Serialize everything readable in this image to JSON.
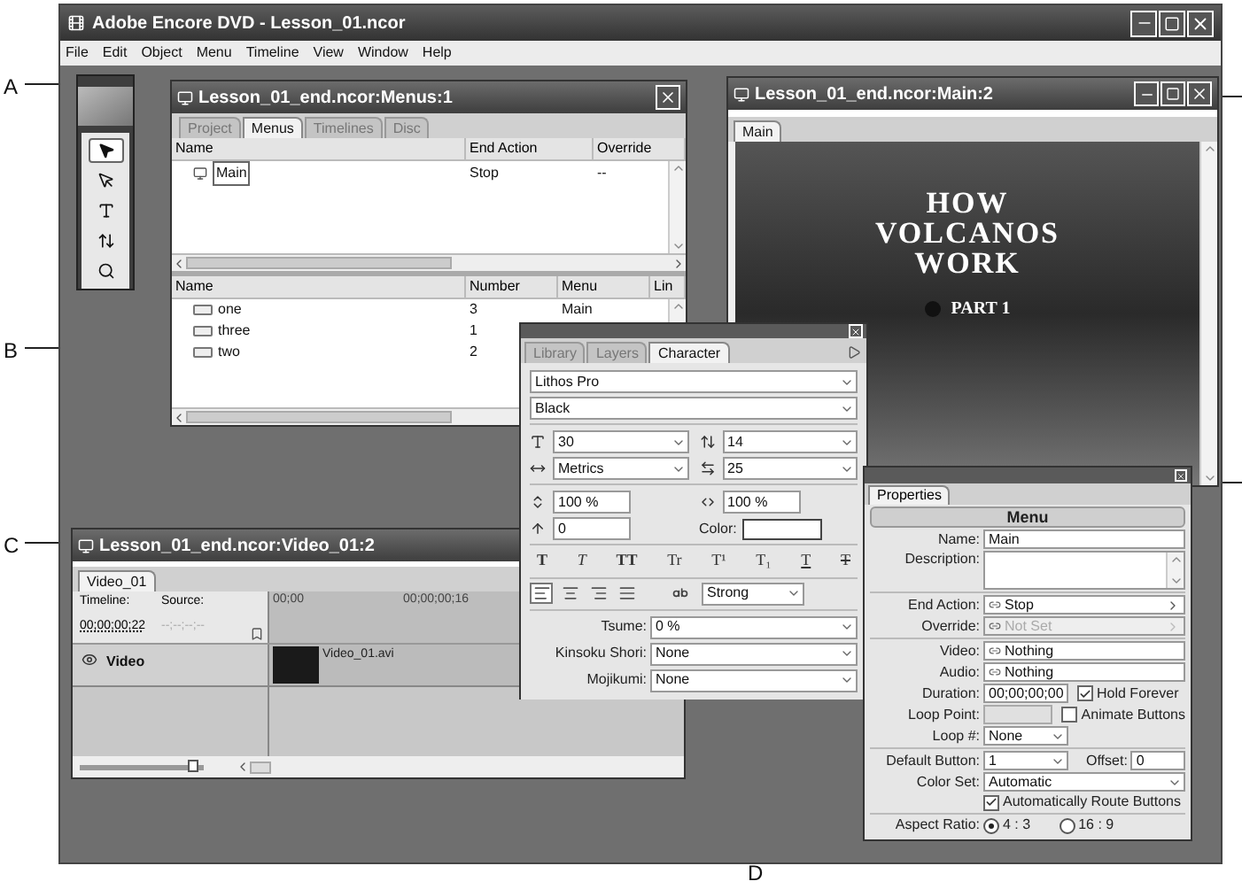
{
  "callouts": [
    {
      "label": "A"
    },
    {
      "label": "B"
    },
    {
      "label": "C"
    },
    {
      "label": "D"
    }
  ],
  "app": {
    "title": "Adobe Encore DVD - Lesson_01.ncor",
    "menu": [
      "File",
      "Edit",
      "Object",
      "Menu",
      "Timeline",
      "View",
      "Window",
      "Help"
    ]
  },
  "tools": [
    {
      "kind": "select",
      "selected": true
    },
    {
      "kind": "direct",
      "selected": false
    },
    {
      "kind": "text",
      "selected": false
    },
    {
      "kind": "vtext",
      "selected": false
    },
    {
      "kind": "zoom",
      "selected": false
    }
  ],
  "menus_window": {
    "title": "Lesson_01_end.ncor:Menus:1",
    "tabs": [
      {
        "label": "Project",
        "selected": false
      },
      {
        "label": "Menus",
        "selected": true
      },
      {
        "label": "Timelines",
        "selected": false
      },
      {
        "label": "Disc",
        "selected": false
      }
    ],
    "menus_table": {
      "columns": [
        "Name",
        "End Action",
        "Override"
      ],
      "rows": [
        {
          "name": "Main",
          "end_action": "Stop",
          "override": "--"
        }
      ]
    },
    "buttons_table": {
      "columns": [
        "Name",
        "Number",
        "Menu",
        "Lin"
      ],
      "rows": [
        {
          "name": "one",
          "number": "3",
          "menu": "Main"
        },
        {
          "name": "three",
          "number": "1"
        },
        {
          "name": "two",
          "number": "2"
        }
      ]
    }
  },
  "preview_window": {
    "title": "Lesson_01_end.ncor:Main:2",
    "tab": {
      "label": "Main",
      "selected": true
    },
    "headline": [
      "HOW",
      "VOLCANOS",
      "WORK"
    ],
    "button_label": "PART 1"
  },
  "character_panel": {
    "tabs": [
      {
        "label": "Library",
        "selected": false
      },
      {
        "label": "Layers",
        "selected": false
      },
      {
        "label": "Character",
        "selected": true
      }
    ],
    "font": "Lithos Pro",
    "style": "Black",
    "size": "30",
    "leading": "14",
    "kerning": "Metrics",
    "tracking": "25",
    "vertical_scale": "100 %",
    "horizontal_scale": "100 %",
    "baseline_shift": "0",
    "color_label": "Color:",
    "style_buttons": [
      {
        "glyph": "T",
        "kind": "bold"
      },
      {
        "glyph": "T",
        "kind": "italic"
      },
      {
        "glyph": "TT",
        "kind": "caps"
      },
      {
        "glyph": "Tr",
        "kind": "smallcaps"
      },
      {
        "glyph": "T¹",
        "kind": "super"
      },
      {
        "glyph": "T₁",
        "kind": "sub"
      },
      {
        "glyph": "T",
        "kind": "underline"
      },
      {
        "glyph": "T",
        "kind": "strike"
      }
    ],
    "alignments": [
      {
        "kind": "left",
        "selected": true
      },
      {
        "kind": "center",
        "selected": false
      },
      {
        "kind": "right",
        "selected": false
      },
      {
        "kind": "justify",
        "selected": false
      }
    ],
    "antialias": "Strong",
    "tsume": {
      "label": "Tsume:",
      "value": "0 %"
    },
    "kinsoku": {
      "label": "Kinsoku Shori:",
      "value": "None"
    },
    "mojikumi": {
      "label": "Mojikumi:",
      "value": "None"
    }
  },
  "properties": {
    "tab": "Properties",
    "header": "Menu",
    "name": {
      "label": "Name:",
      "value": "Main"
    },
    "description": {
      "label": "Description:"
    },
    "end_action": {
      "label": "End Action:",
      "value": "Stop",
      "disabled": false
    },
    "override": {
      "label": "Override:",
      "value": "Not Set",
      "disabled": true
    },
    "video": {
      "label": "Video:",
      "value": "Nothing"
    },
    "audio": {
      "label": "Audio:",
      "value": "Nothing"
    },
    "duration": {
      "label": "Duration:",
      "value": "00;00;00;00"
    },
    "hold_forever": {
      "label": "Hold Forever",
      "checked": true
    },
    "loop_point": {
      "label": "Loop Point:"
    },
    "animate_buttons": {
      "label": "Animate Buttons",
      "checked": false
    },
    "loop": {
      "label": "Loop #:",
      "value": "None"
    },
    "default_button": {
      "label": "Default Button:",
      "value": "1"
    },
    "offset": {
      "label": "Offset:",
      "value": "0"
    },
    "color_set": {
      "label": "Color Set:",
      "value": "Automatic"
    },
    "auto_route": {
      "label": "Automatically Route Buttons",
      "checked": true
    },
    "aspect_ratio": {
      "label": "Aspect Ratio:",
      "options": [
        {
          "label": "4 : 3",
          "selected": true
        },
        {
          "label": "16 : 9",
          "selected": false
        }
      ]
    }
  },
  "video_window": {
    "title": "Lesson_01_end.ncor:Video_01:2",
    "tab": {
      "label": "Video_01",
      "selected": true
    },
    "timeline_label": "Timeline:",
    "timeline_value": "00;00;00;22",
    "source_label": "Source:",
    "source_value": "--;--;--;--",
    "ruler": [
      "00;00",
      "00;00;00;16"
    ],
    "track": "Video",
    "clip": "Video_01.avi",
    "zoom": {
      "level": 0.92
    }
  }
}
